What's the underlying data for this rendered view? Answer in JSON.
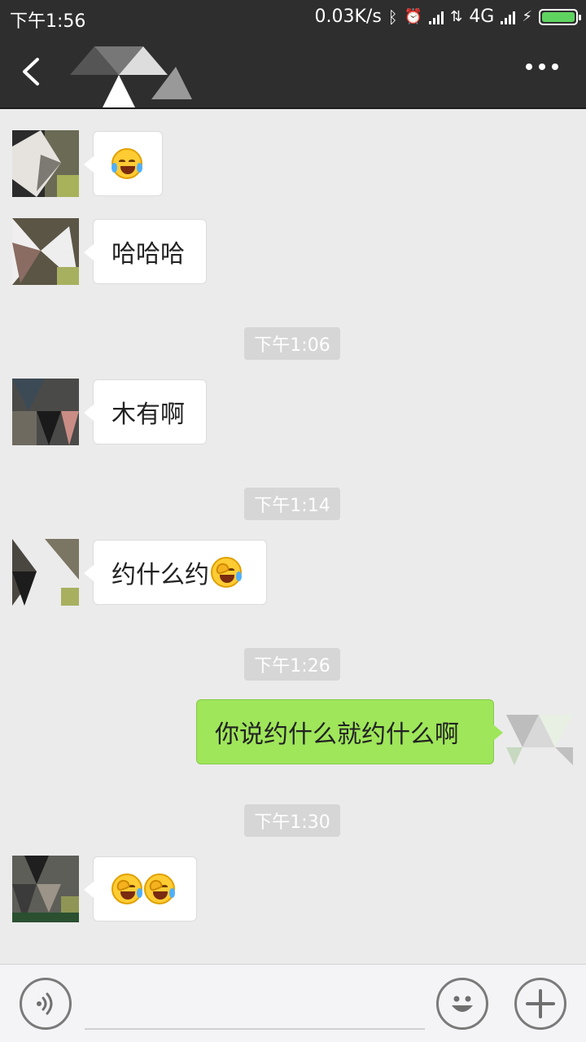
{
  "status_bar": {
    "time": "下午1:56",
    "network_speed": "0.03K/s",
    "network_type": "4G",
    "icons": [
      "bluetooth-icon",
      "alarm-off-icon",
      "signal-icon",
      "data-arrows-icon",
      "signal-icon",
      "charging-icon",
      "battery-icon"
    ]
  },
  "header": {
    "back_icon": "chevron-left-icon",
    "more_icon": "more-dots-icon"
  },
  "messages": [
    {
      "side": "in",
      "text": "",
      "emojis": [
        "tears-of-joy"
      ]
    },
    {
      "side": "in",
      "text": "哈哈哈"
    },
    {
      "timestamp": "下午1:06"
    },
    {
      "side": "in",
      "text": "木有啊"
    },
    {
      "timestamp": "下午1:14"
    },
    {
      "side": "in",
      "text": "约什么约",
      "emojis": [
        "facepalm"
      ]
    },
    {
      "timestamp": "下午1:26"
    },
    {
      "side": "out",
      "text": "你说约什么就约什么啊"
    },
    {
      "timestamp": "下午1:30"
    },
    {
      "side": "in",
      "text": "",
      "emojis": [
        "facepalm",
        "facepalm"
      ]
    }
  ],
  "input_bar": {
    "voice_icon": "voice-icon",
    "emoji_icon": "emoji-icon",
    "plus_icon": "plus-icon"
  },
  "colors": {
    "header_bg": "#2e2e2e",
    "chat_bg": "#ebebeb",
    "incoming_bubble": "#ffffff",
    "outgoing_bubble": "#9fe65a",
    "timestamp_bg": "#d6d6d6"
  }
}
